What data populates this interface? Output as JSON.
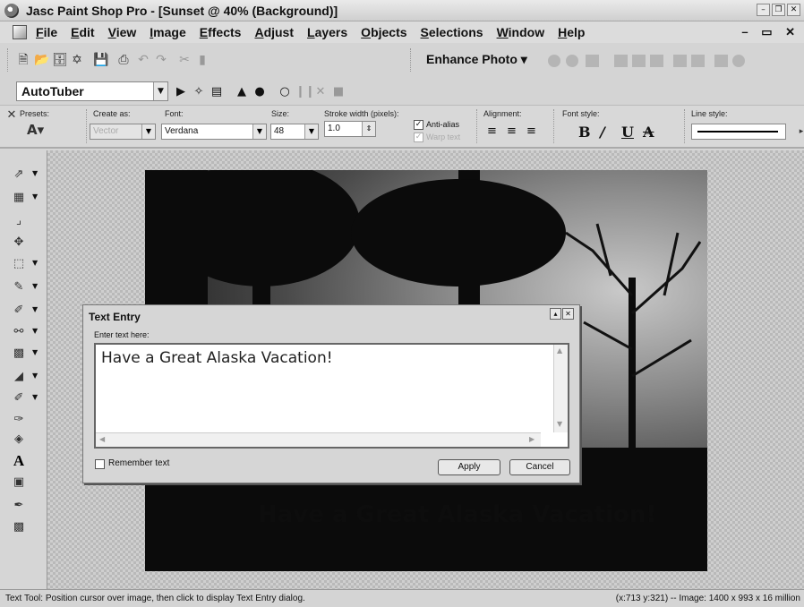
{
  "window": {
    "title": "Jasc Paint Shop Pro - [Sunset @ 40% (Background)]"
  },
  "menu": [
    "File",
    "Edit",
    "View",
    "Image",
    "Effects",
    "Adjust",
    "Layers",
    "Objects",
    "Selections",
    "Window",
    "Help"
  ],
  "toolbar": {
    "enhance_label": "Enhance Photo ▾"
  },
  "script_toolbar": {
    "script_name": "AutoTuber"
  },
  "tool_options": {
    "presets_label": "Presets:",
    "create_as_label": "Create as:",
    "create_as_value": "Vector",
    "font_label": "Font:",
    "font_value": "Verdana",
    "size_label": "Size:",
    "size_value": "48",
    "stroke_label": "Stroke width (pixels):",
    "stroke_value": "1.0",
    "antialias_label": "Anti-alias",
    "warp_label": "Warp text",
    "alignment_label": "Alignment:",
    "font_style_label": "Font style:",
    "line_style_label": "Line style:"
  },
  "canvas": {
    "text": "Have a Great Alaska Vacation!"
  },
  "dialog": {
    "title": "Text Entry",
    "prompt": "Enter text here:",
    "text_value": "Have a Great Alaska Vacation!",
    "remember_label": "Remember text",
    "apply_label": "Apply",
    "cancel_label": "Cancel"
  },
  "status": {
    "message": "Text Tool: Position cursor over image, then click to display Text Entry dialog.",
    "info": "(x:713 y:321) -- Image:  1400 x 993 x 16 million"
  }
}
